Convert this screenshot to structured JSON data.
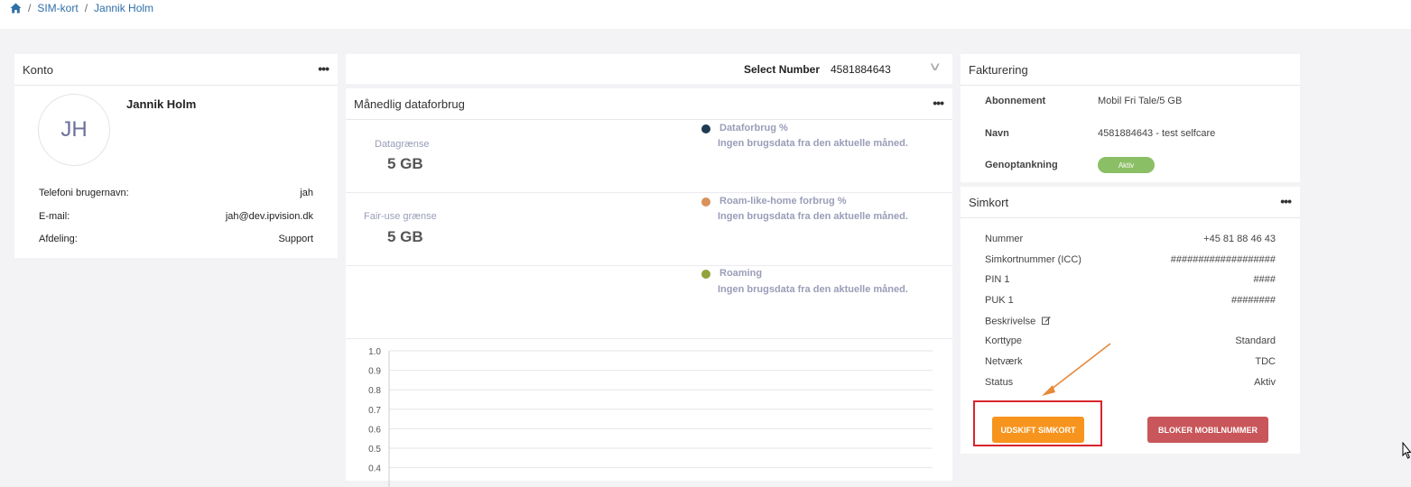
{
  "breadcrumb": {
    "items": [
      "SIM-kort",
      "Jannik Holm"
    ]
  },
  "konto": {
    "title": "Konto",
    "initials": "JH",
    "name": "Jannik Holm",
    "rows": [
      {
        "label": "Telefoni brugernavn:",
        "value": "jah"
      },
      {
        "label": "E-mail:",
        "value": "jah@dev.ipvision.dk"
      },
      {
        "label": "Afdeling:",
        "value": "Support"
      }
    ]
  },
  "select_number": {
    "label": "Select Number",
    "value": "4581884643"
  },
  "usage": {
    "title": "Månedlig dataforbrug",
    "limits": [
      {
        "label": "Datagrænse",
        "value": "5 GB"
      },
      {
        "label": "Fair-use grænse",
        "value": "5 GB"
      }
    ],
    "legend": [
      {
        "title": "Dataforbrug %",
        "sub": "Ingen brugsdata fra den aktuelle måned.",
        "color": "#1f3b52"
      },
      {
        "title": "Roam-like-home forbrug %",
        "sub": "Ingen brugsdata fra den aktuelle måned.",
        "color": "#d9925b"
      },
      {
        "title": "Roaming",
        "sub": "Ingen brugsdata fra den aktuelle måned.",
        "color": "#8fa33a"
      }
    ]
  },
  "chart_data": {
    "type": "line",
    "y_ticks": [
      "1.0",
      "0.9",
      "0.8",
      "0.7",
      "0.6",
      "0.5",
      "0.4"
    ],
    "ylim": [
      0.4,
      1.0
    ],
    "grid": true
  },
  "fakturering": {
    "title": "Fakturering",
    "rows": [
      {
        "label": "Abonnement",
        "value": "Mobil Fri Tale/5 GB"
      },
      {
        "label": "Navn",
        "value": "4581884643 - test selfcare"
      },
      {
        "label": "Genoptankning",
        "value": "Aktiv"
      }
    ]
  },
  "simkort": {
    "title": "Simkort",
    "rows": [
      {
        "label": "Nummer",
        "value": "+45 81 88 46 43"
      },
      {
        "label": "Simkortnummer (ICC)",
        "value": "###################"
      },
      {
        "label": "PIN 1",
        "value": "####"
      },
      {
        "label": "PUK 1",
        "value": "########"
      },
      {
        "label": "Beskrivelse",
        "value": ""
      },
      {
        "label": "Korttype",
        "value": "Standard"
      },
      {
        "label": "Netværk",
        "value": "TDC"
      },
      {
        "label": "Status",
        "value": "Aktiv"
      }
    ],
    "buttons": {
      "replace": "UDSKIFT SIMKORT",
      "block": "BLOKER MOBILNUMMER"
    }
  },
  "colors": {
    "accent": "#2f6fa7",
    "orange": "#f7941d",
    "red": "#c9565a",
    "badge": "#8bbf66",
    "highlight": "#d9242b"
  }
}
